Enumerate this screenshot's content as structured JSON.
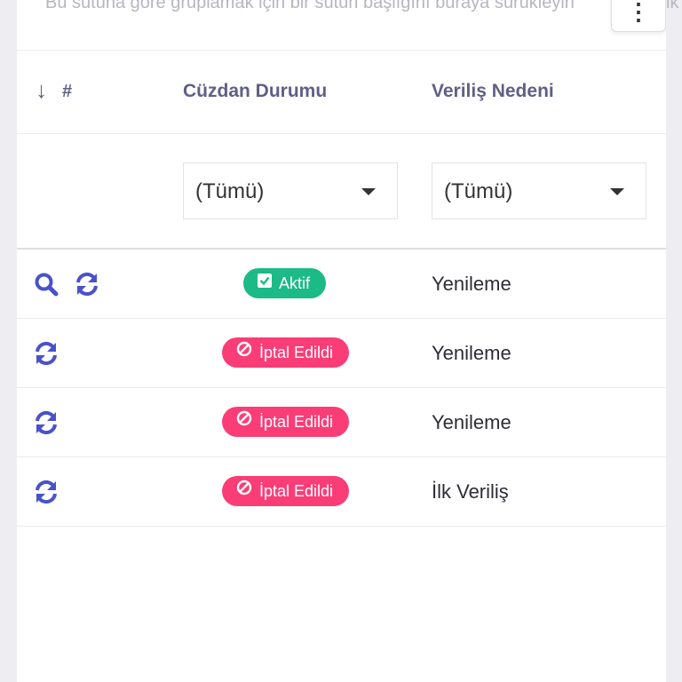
{
  "toolbar": {
    "group_hint": "Bu sütuna göre gruplamak için bir sütun başlığını buraya sürükleyin",
    "right_clip": "ik",
    "menu_label": "⋮"
  },
  "columns": {
    "index_label": "#",
    "sort_arrow": "↓",
    "wallet_status": "Cüzdan Durumu",
    "issue_reason": "Veriliş Nedeni"
  },
  "filters": {
    "wallet_status": "(Tümü)",
    "issue_reason": "(Tümü)"
  },
  "rows": [
    {
      "status": "Aktif",
      "reason": "Yenileme"
    },
    {
      "status": "İptal Edildi",
      "reason": "Yenileme"
    },
    {
      "status": "İptal Edildi",
      "reason": "Yenileme"
    },
    {
      "status": "İptal Edildi",
      "reason": "İlk Veriliş"
    }
  ],
  "colors": {
    "active": "#1cba86",
    "cancelled": "#fb3d77",
    "icon": "#4a52c9",
    "header_text": "#5f5f86"
  },
  "icons": [
    "search-icon",
    "refresh-icon",
    "check-square-icon",
    "ban-icon",
    "sort-arrow-icon",
    "caret-down-icon",
    "more-vertical-icon"
  ]
}
